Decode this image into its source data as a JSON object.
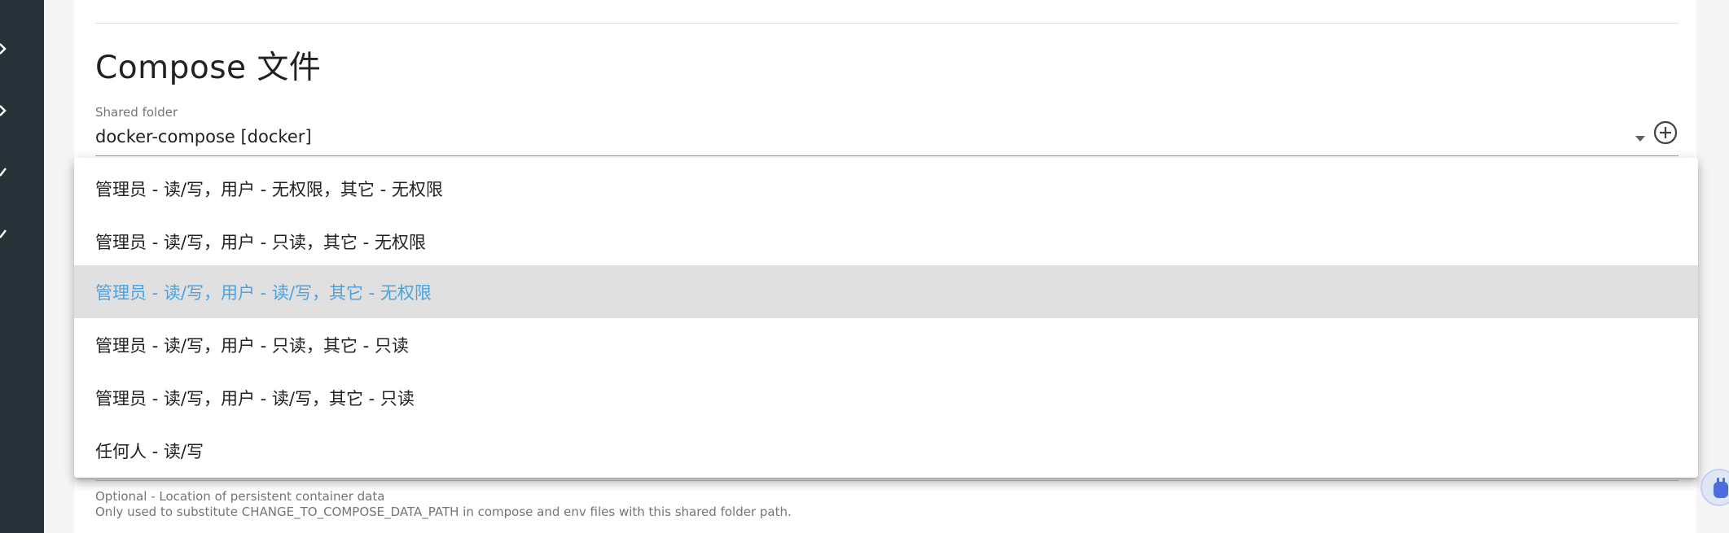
{
  "section": {
    "title": "Compose 文件"
  },
  "shared_folder": {
    "label": "Shared folder",
    "value": "docker-compose [docker]"
  },
  "permissions_menu": {
    "options": [
      "管理员 - 读/写，用户 - 无权限，其它 - 无权限",
      "管理员 - 读/写，用户 - 只读，其它 - 无权限",
      "管理员 - 读/写，用户 - 读/写，其它 - 无权限",
      "管理员 - 读/写，用户 - 只读，其它 - 只读",
      "管理员 - 读/写，用户 - 读/写，其它 - 只读",
      "任何人 - 读/写"
    ],
    "selected_index": 2
  },
  "data_path_hint": {
    "line1": "Optional - Location of persistent container data",
    "line2": "Only used to substitute CHANGE_TO_COMPOSE_DATA_PATH in compose and env files with this shared folder path."
  },
  "colors": {
    "sidebar": "#263238",
    "selected_text": "#4aa3df",
    "selected_bg": "#e0e0e0"
  },
  "icons": {
    "dropdown": "arrow-drop-down-icon",
    "add": "add-circle-outline-icon",
    "sidebar": "chevron-right-icon",
    "fab": "puzzle-piece-icon"
  }
}
